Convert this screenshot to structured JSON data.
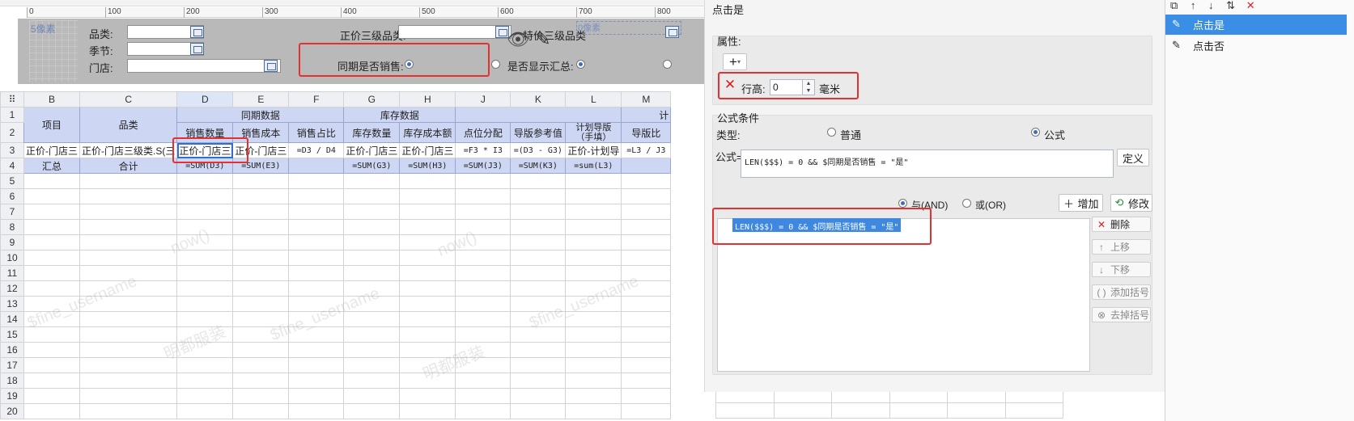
{
  "ruler": {
    "ticks": [
      "0",
      "100",
      "200",
      "300",
      "400",
      "500",
      "600",
      "700",
      "800"
    ]
  },
  "params": {
    "size_label": "5像素",
    "category_label": "品类:",
    "season_label": "季节:",
    "store_label": "门店:",
    "level3_label": "正价三级品类:",
    "promo_label": "特价三级品类",
    "same_period_label": "同期是否销售:",
    "show_total_label": "是否显示汇总:",
    "pixel_hint": "0像素"
  },
  "sheet": {
    "col_headers": [
      "B",
      "C",
      "D",
      "E",
      "F",
      "G",
      "H",
      "J",
      "K",
      "L",
      "M"
    ],
    "row_numbers": [
      "1",
      "2",
      "3",
      "4",
      "5",
      "6",
      "7",
      "8",
      "9",
      "10",
      "11",
      "12",
      "13",
      "14",
      "15",
      "16",
      "17",
      "18",
      "19",
      "20"
    ],
    "item": "项目",
    "category": "品类",
    "group_same": "同期数据",
    "group_stock": "库存数据",
    "group_plan": "计",
    "headers_r2": [
      "销售数量",
      "销售成本",
      "销售占比",
      "库存数量",
      "库存成本额",
      "点位分配",
      "导版参考值",
      "计划导版（手填）",
      "导版比"
    ],
    "r3": [
      "正价-门店三",
      "正价-门店三级类.S(三",
      "正价-门店三",
      "正价-门店三",
      "=D3 / D4",
      "正价-门店三",
      "正价-门店三",
      "=F3 * I3",
      "=(D3 - G3)",
      "正价-计划导",
      "=L3 / J3"
    ],
    "r4": [
      "汇总",
      "合计",
      "=SUM(D3)",
      "=SUM(E3)",
      "",
      "=SUM(G3)",
      "=SUM(H3)",
      "=SUM(J3)",
      "=SUM(K3)",
      "=sum(L3)",
      ""
    ]
  },
  "watermarks": [
    "now()",
    "now()",
    "$fine_username",
    "$fine_username",
    "$fine_username",
    "明都服装",
    "明都服装"
  ],
  "panel": {
    "title": "点击是",
    "properties_label": "属性:",
    "add_symbol": "+",
    "row_height_label": "行高:",
    "row_height_value": "0",
    "unit": "毫米",
    "condition_label": "公式条件",
    "type_label": "类型:",
    "type_normal": "普通",
    "type_formula": "公式",
    "formula_label": "公式=",
    "formula_value": "LEN($$$) = 0 && $同期是否销售 = \"是\"",
    "define_btn": "定义",
    "and_label": "与(AND)",
    "or_label": "或(OR)",
    "add_btn": "增加",
    "modify_btn": "修改",
    "condition_item": "LEN($$$) = 0 && $同期是否销售 = \"是\"",
    "delete_btn": "删除",
    "up_btn": "上移",
    "down_btn": "下移",
    "add_bracket_btn": "添加括号",
    "remove_bracket_btn": "去掉括号"
  },
  "list": {
    "items": [
      "点击是",
      "点击否"
    ],
    "selected_index": 0
  },
  "colors": {
    "accent": "#3b8ee6",
    "highlight_red": "#e53030",
    "header_blue": "#cdd6f3"
  }
}
